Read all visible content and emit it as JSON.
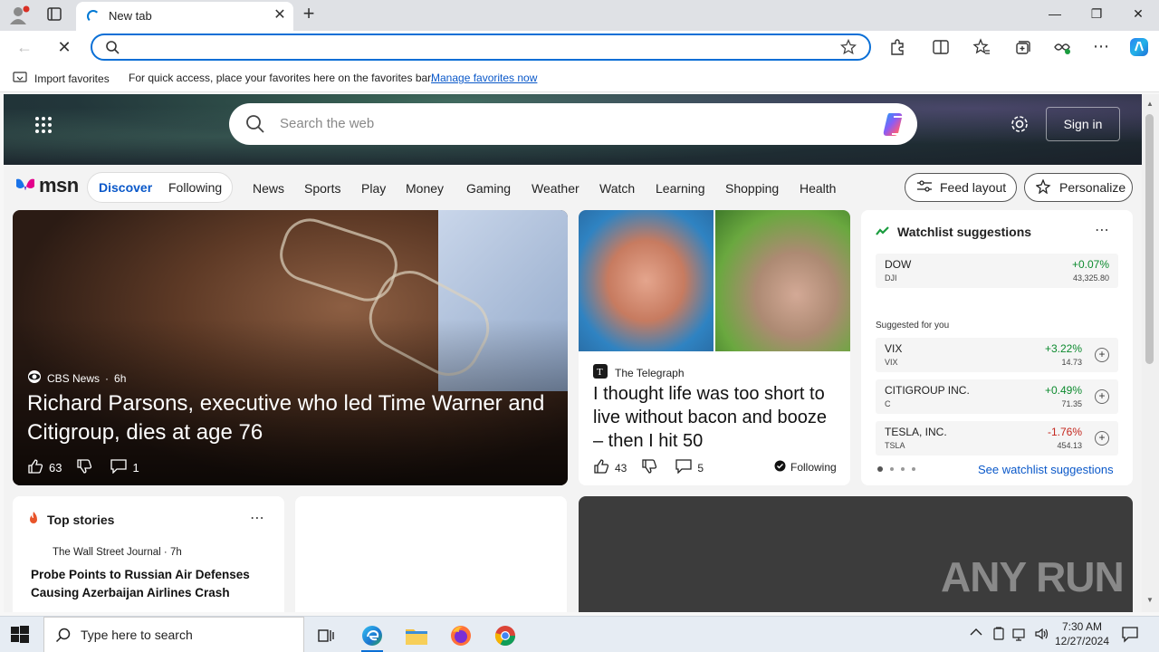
{
  "browser": {
    "tab_title": "New tab",
    "address_value": "",
    "address_placeholder": ""
  },
  "favorites_bar": {
    "import_label": "Import favorites",
    "message": "For quick access, place your favorites here on the favorites bar.",
    "manage_link": "Manage favorites now"
  },
  "msn": {
    "search_placeholder": "Search the web",
    "sign_in": "Sign in",
    "logo_text": "msn",
    "feed_tabs": [
      "Discover",
      "Following"
    ],
    "nav_items": [
      "News",
      "Sports",
      "Play",
      "Money",
      "Gaming",
      "Weather",
      "Watch",
      "Learning",
      "Shopping",
      "Health"
    ],
    "feed_layout": "Feed layout",
    "personalize": "Personalize"
  },
  "hero_story": {
    "source": "CBS News",
    "age": "6h",
    "headline": "Richard Parsons, executive who led Time Warner and Citigroup, dies at age 76",
    "likes": "63",
    "comments": "1"
  },
  "telegraph_story": {
    "source": "The Telegraph",
    "headline": "I thought life was too short to live without bacon and booze – then I hit 50",
    "likes": "43",
    "comments": "5",
    "following": "Following"
  },
  "watchlist": {
    "title": "Watchlist suggestions",
    "main": {
      "symbol": "DOW",
      "ticker": "DJI",
      "change": "+0.07%",
      "value": "43,325.80",
      "direction": "up"
    },
    "suggested_label": "Suggested for you",
    "suggestions": [
      {
        "symbol": "VIX",
        "ticker": "VIX",
        "change": "+3.22%",
        "value": "14.73",
        "direction": "up"
      },
      {
        "symbol": "CITIGROUP INC.",
        "ticker": "C",
        "change": "+0.49%",
        "value": "71.35",
        "direction": "up"
      },
      {
        "symbol": "TESLA, INC.",
        "ticker": "TSLA",
        "change": "-1.76%",
        "value": "454.13",
        "direction": "down"
      }
    ],
    "see_all": "See watchlist suggestions"
  },
  "top_stories": {
    "title": "Top stories",
    "source": "The Wall Street Journal · 7h",
    "headline": "Probe Points to Russian Air Defenses Causing Azerbaijan Airlines Crash"
  },
  "watermark": "ANY RUN",
  "taskbar": {
    "search_placeholder": "Type here to search",
    "time": "7:30 AM",
    "date": "12/27/2024"
  },
  "colors": {
    "accent": "#0a6fd6",
    "up": "#0c8a2e",
    "down": "#c4261d"
  }
}
